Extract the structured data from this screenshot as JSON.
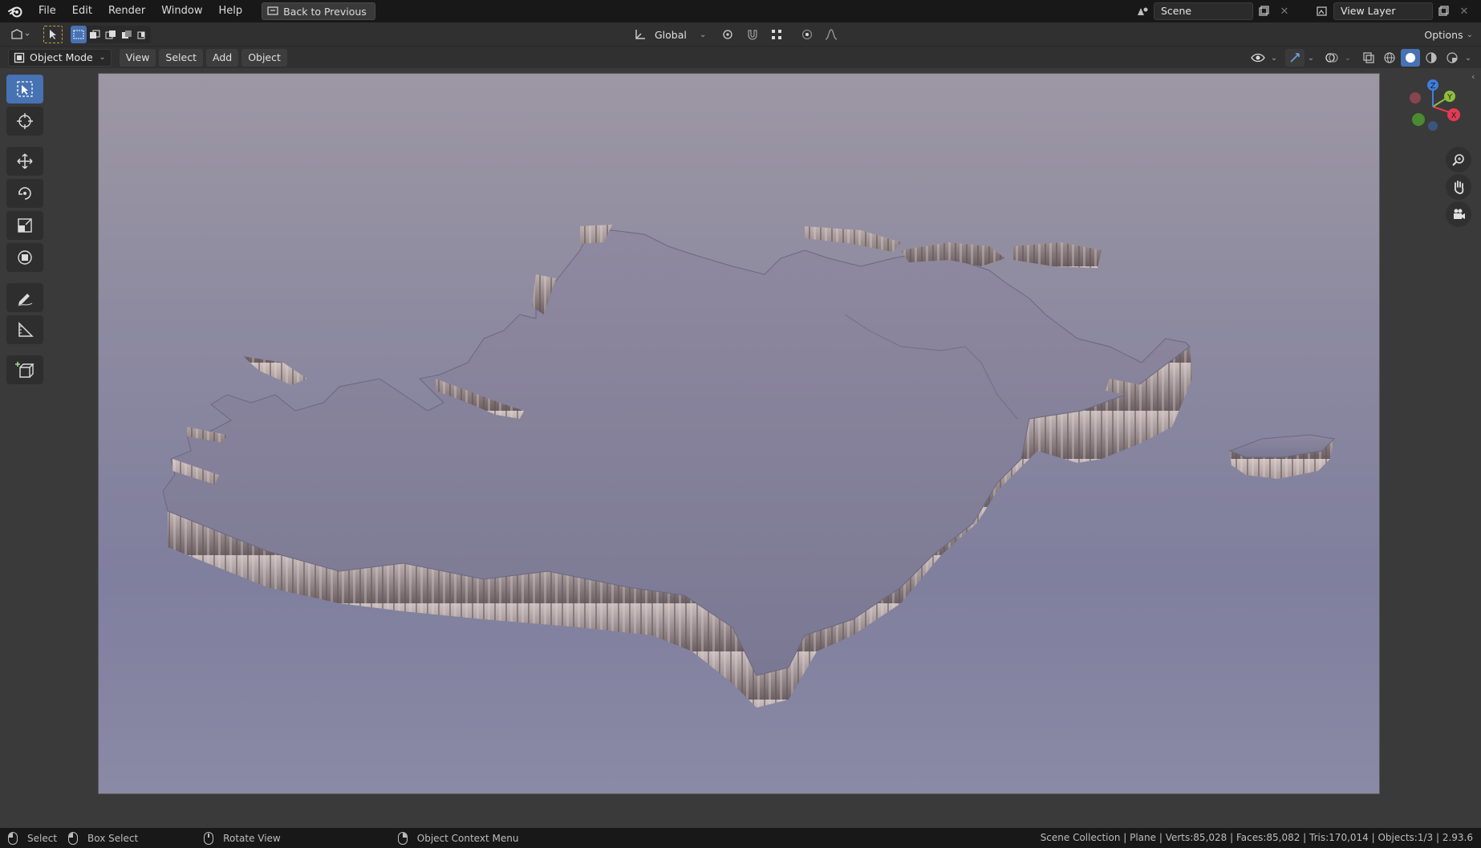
{
  "menu": {
    "items": [
      "File",
      "Edit",
      "Render",
      "Window",
      "Help"
    ],
    "back_button": "Back to Previous"
  },
  "top_right": {
    "scene_name": "Scene",
    "view_layer": "View Layer"
  },
  "tool_header": {
    "transform_orientation": "Global",
    "options_label": "Options"
  },
  "view_header": {
    "mode": "Object Mode",
    "view": "View",
    "select": "Select",
    "add": "Add",
    "object": "Object"
  },
  "toolbar_tools": [
    "select-box",
    "cursor",
    "move",
    "rotate",
    "scale",
    "transform",
    "annotate",
    "measure",
    "add-cube"
  ],
  "gizmo": {
    "axes": [
      "X",
      "Y",
      "Z"
    ],
    "colors": {
      "x": "#e53a52",
      "y": "#8fbf3a",
      "z": "#3d7fe0"
    }
  },
  "status": {
    "select": "Select",
    "box_select": "Box Select",
    "rotate_view": "Rotate View",
    "context_menu": "Object Context Menu",
    "stats": "Scene Collection | Plane | Verts:85,028 | Faces:85,082 | Tris:170,014 | Objects:1/3 | 2.93.6"
  },
  "colors": {
    "accent": "#4772b3",
    "viewport_top": "#9d97a4",
    "viewport_bottom": "#8a8aa6"
  }
}
